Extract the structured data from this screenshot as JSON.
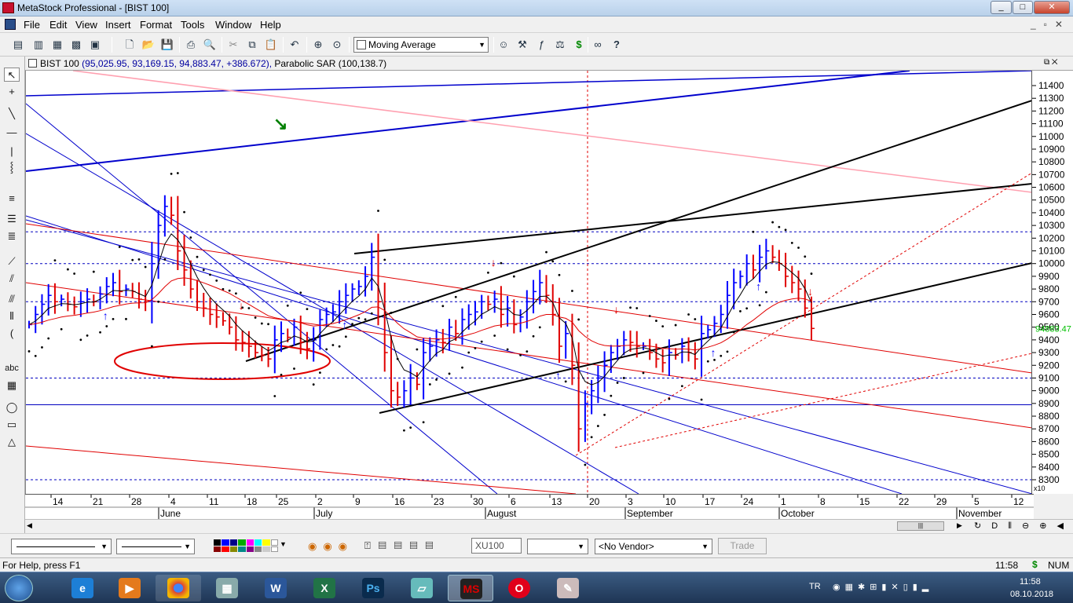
{
  "window": {
    "title": "MetaStock Professional - [BIST 100]",
    "min": "_",
    "max": "□",
    "close": "✕"
  },
  "menu": [
    "File",
    "Edit",
    "View",
    "Insert",
    "Format",
    "Tools",
    "Window",
    "Help"
  ],
  "toolbar": {
    "indicator_combo": "Moving Average"
  },
  "chart_header": {
    "symbol": "BIST 100",
    "ohlc": "(95,025.95, 93,169.15, 94,883.47, +386.672),",
    "indicator": "Parabolic SAR",
    "indicator_params": "(100,138.7)"
  },
  "chart_data": {
    "type": "bar",
    "title": "BIST 100",
    "ylim": [
      8200,
      11500
    ],
    "y_ticks": [
      8300,
      8400,
      8500,
      8600,
      8700,
      8800,
      8900,
      9000,
      9100,
      9200,
      9300,
      9400,
      9500,
      9600,
      9700,
      9800,
      9900,
      10000,
      10100,
      10200,
      10300,
      10400,
      10500,
      10600,
      10700,
      10800,
      10900,
      11000,
      11100,
      11200,
      11300,
      11400
    ],
    "y_tick_labels": [
      "8300",
      "8400",
      "8500",
      "8600",
      "8700",
      "8800",
      "8900",
      "9000",
      "9100",
      "9200",
      "9300",
      "9400",
      "9500",
      "9600",
      "9700",
      "9800",
      "9900",
      "10000",
      "10100",
      "10200",
      "10300",
      "10400",
      "10500",
      "10600",
      "10700",
      "10800",
      "10900",
      "11000",
      "11100",
      "11200",
      "11300",
      "11400"
    ],
    "scale_note": "x10",
    "last_price_label": "94883.47",
    "last_price": 9488.3,
    "x_day_labels": [
      "14",
      "21",
      "28",
      "4",
      "11",
      "18",
      "25",
      "2",
      "9",
      "16",
      "23",
      "30",
      "6",
      "13",
      "20",
      "3",
      "10",
      "17",
      "24",
      "1",
      "8",
      "15",
      "22",
      "29",
      "5",
      "12"
    ],
    "x_month_labels": [
      "June",
      "July",
      "August",
      "September",
      "October",
      "November"
    ],
    "series": [
      {
        "name": "BIST 100",
        "closes": [
          9520,
          9600,
          9680,
          9750,
          9700,
          9720,
          9680,
          9660,
          9700,
          9720,
          9700,
          9760,
          9820,
          9850,
          9780,
          9800,
          9780,
          9720,
          9700,
          10000,
          10300,
          10450,
          10380,
          10100,
          9950,
          9800,
          9700,
          9650,
          9600,
          9580,
          9550,
          9500,
          9400,
          9380,
          9350,
          9300,
          9280,
          9250,
          9400,
          9450,
          9420,
          9500,
          9380,
          9330,
          9400,
          9560,
          9600,
          9620,
          9700,
          9750,
          9800,
          9820,
          9900,
          10050,
          9700,
          9300,
          9000,
          8950,
          9000,
          9100,
          9050,
          9300,
          9350,
          9400,
          9380,
          9500,
          9450,
          9560,
          9600,
          9620,
          9700,
          9680,
          9720,
          9600,
          9650,
          9520,
          9580,
          9700,
          9780,
          9850,
          9750,
          9600,
          9350,
          9450,
          9200,
          8700,
          8900,
          9000,
          9100,
          9200,
          9300,
          9350,
          9400,
          9380,
          9350,
          9350,
          9300,
          9250,
          9220,
          9300,
          9280,
          9350,
          9300,
          9250,
          9450,
          9480,
          9530,
          9600,
          9750,
          9850,
          9900,
          10000,
          9950,
          10050,
          10100,
          10050,
          10000,
          9900,
          9850,
          9800,
          9650,
          9490
        ],
        "color_up": "#0000ff",
        "color_down": "#e00000"
      }
    ],
    "colors": {
      "up": "#0000ff",
      "down": "#e00000",
      "sar": "#000000",
      "ma_fast": "#000000",
      "ma_slow": "#e00000",
      "arrow_up": "#0000ff",
      "arrow_down": "#e00000",
      "green_arrow": "#008000"
    }
  },
  "bottom": {
    "symbol_box": "XU100",
    "vendor_combo": "<No Vendor>",
    "trade_button": "Trade"
  },
  "status": {
    "help": "For Help, press F1",
    "time": "11:58",
    "currency": "$",
    "num": "NUM"
  },
  "taskbar": {
    "lang": "TR",
    "clock_time": "11:58",
    "clock_date": "08.10.2018"
  }
}
